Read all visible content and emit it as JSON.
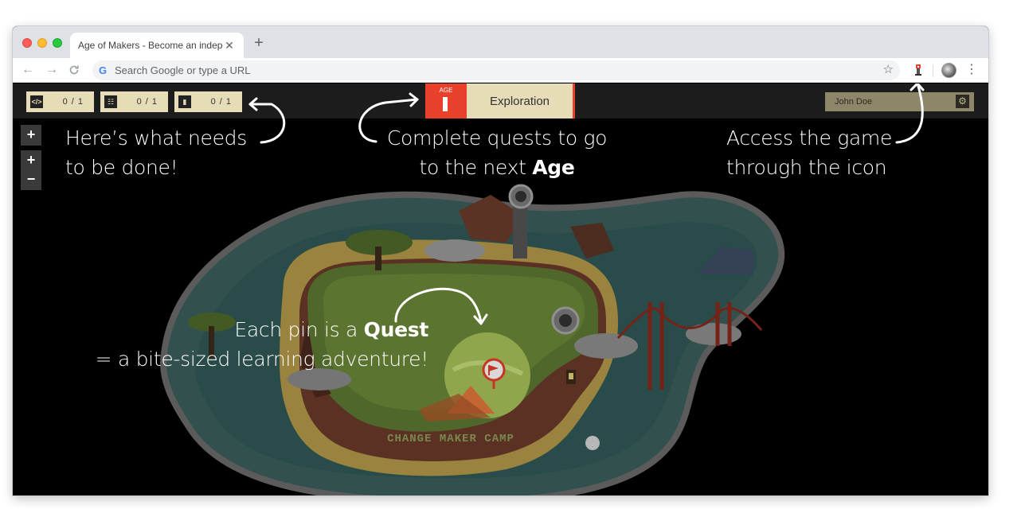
{
  "browser": {
    "tab_title": "Age of Makers - Become an indepe",
    "tab_close": "✕",
    "new_tab": "+",
    "back": "←",
    "forward": "→",
    "reload": "C",
    "omnibox_placeholder": "Search Google or type a URL",
    "star": "☆",
    "menu": "⋮"
  },
  "hud": {
    "counters": [
      {
        "icon": "code-icon",
        "glyph": "</>",
        "value": "0 / 1"
      },
      {
        "icon": "tree-icon",
        "glyph": "☷",
        "value": "0 / 1"
      },
      {
        "icon": "book-icon",
        "glyph": "▮",
        "value": "0 / 1"
      }
    ],
    "age_label": "AGE",
    "age_name": "Exploration",
    "user_name": "John Doe",
    "settings_glyph": "⚙"
  },
  "zoom": {
    "plus": "+",
    "minus": "−"
  },
  "captions": {
    "todo_line1": "Here’s what needs",
    "todo_line2": "to be done!",
    "age_line1": "Complete quests to go",
    "age_line2_prefix": "to the next ",
    "age_line2_bold": "Age",
    "access_line1": "Access the game",
    "access_line2": "through the icon",
    "quest_line1_prefix": "Each pin is a ",
    "quest_line1_bold": "Quest",
    "quest_line2": "= a bite-sized learning adventure!"
  },
  "map": {
    "camp_sign": "CHANGE MAKER CAMP"
  },
  "colors": {
    "accent_red": "#e8402a",
    "hud_beige": "#e6dcb8",
    "sea": "#3b6f6a",
    "land": "#6e8a3c"
  }
}
